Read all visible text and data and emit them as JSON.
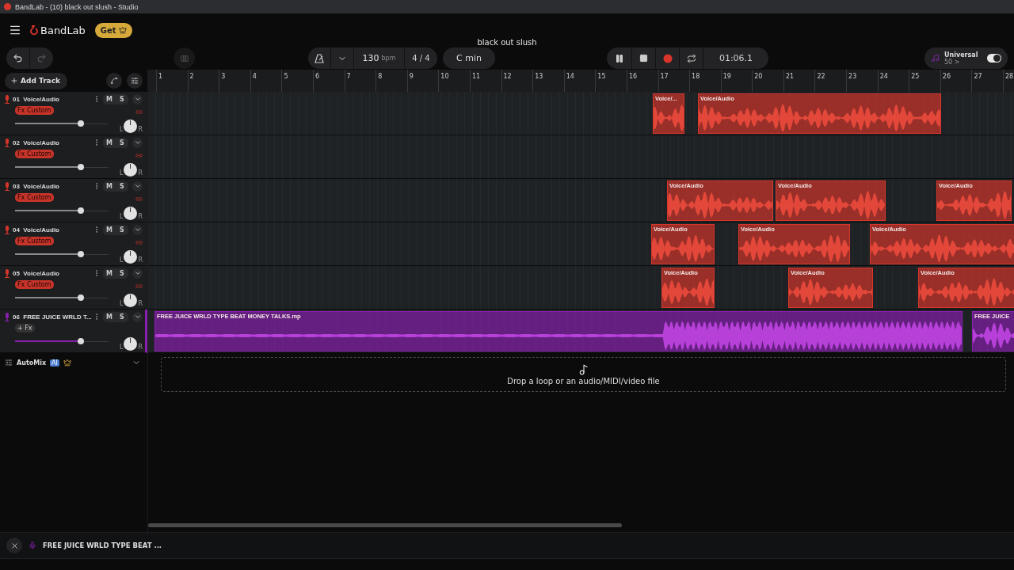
{
  "window": {
    "title": "BandLab - (10) black out slush - Studio"
  },
  "header": {
    "brand": "BandLab",
    "get_button": "Get",
    "project_title": "black out slush"
  },
  "toolbar": {
    "tempo": "130",
    "tempo_unit": "bpm",
    "time_signature": "4 / 4",
    "key": "C min",
    "time": "01:06.1",
    "preset": {
      "name": "Universal",
      "value": "50 >",
      "on": true
    }
  },
  "track_panel": {
    "add_track": "Add Track"
  },
  "ruler": [
    "1",
    "2",
    "3",
    "4",
    "5",
    "6",
    "7",
    "8",
    "9",
    "10",
    "11",
    "12",
    "13",
    "14",
    "15",
    "16",
    "17",
    "18",
    "19",
    "20",
    "21",
    "22",
    "23",
    "24",
    "25",
    "26",
    "27",
    "28"
  ],
  "tracks": [
    {
      "number": "01",
      "name": "Voice/Audio",
      "fx": "Fx Custom",
      "fx_active": true,
      "color": "#d9362b",
      "selected": false,
      "level": 0.7,
      "pan_left": "L",
      "pan_right": "R",
      "mute": "M",
      "solo": "S",
      "clips": [
        {
          "label": "Voice/..."
        },
        {
          "label": "Voice/Audio"
        }
      ]
    },
    {
      "number": "02",
      "name": "Voice/Audio",
      "fx": "Fx Custom",
      "fx_active": true,
      "color": "#d9362b",
      "selected": false,
      "level": 0.7,
      "pan_left": "L",
      "pan_right": "R",
      "mute": "M",
      "solo": "S"
    },
    {
      "number": "03",
      "name": "Voice/Audio",
      "fx": "Fx Custom",
      "fx_active": true,
      "color": "#d9362b",
      "selected": false,
      "level": 0.7,
      "pan_left": "L",
      "pan_right": "R",
      "mute": "M",
      "solo": "S",
      "clips": [
        {
          "label": "Voice/Audio"
        },
        {
          "label": "Voice/Audio"
        },
        {
          "label": "Voice/Audio"
        }
      ]
    },
    {
      "number": "04",
      "name": "Voice/Audio",
      "fx": "Fx Custom",
      "fx_active": true,
      "color": "#d9362b",
      "selected": false,
      "level": 0.7,
      "pan_left": "L",
      "pan_right": "R",
      "mute": "M",
      "solo": "S",
      "clips": [
        {
          "label": "Voice/Audio"
        },
        {
          "label": "Voice/Audio"
        },
        {
          "label": "Voice/Audio"
        }
      ]
    },
    {
      "number": "05",
      "name": "Voice/Audio",
      "fx": "Fx Custom",
      "fx_active": true,
      "color": "#d9362b",
      "selected": false,
      "level": 0.7,
      "pan_left": "L",
      "pan_right": "R",
      "mute": "M",
      "solo": "S",
      "clips": [
        {
          "label": "Voice/Audio"
        },
        {
          "label": "Voice/Audio"
        },
        {
          "label": "Voice/Audio"
        }
      ]
    },
    {
      "number": "06",
      "name": "FREE JUICE WRLD T...",
      "fx": "+ Fx",
      "fx_active": false,
      "color": "#8a1fb0",
      "selected": true,
      "level": 0.7,
      "pan_left": "L",
      "pan_right": "R",
      "mute": "M",
      "solo": "S",
      "clips": [
        {
          "label": "FREE JUICE WRLD TYPE BEAT MONEY TALKS.mp"
        },
        {
          "label": "FREE JUICE"
        }
      ]
    }
  ],
  "automix": {
    "label": "AutoMix",
    "badge": "AI"
  },
  "drop_zone": {
    "text": "Drop a loop or an audio/MIDI/video file"
  },
  "bottom_bar": {
    "track_name": "FREE JUICE WRLD TYPE BEAT ..."
  }
}
